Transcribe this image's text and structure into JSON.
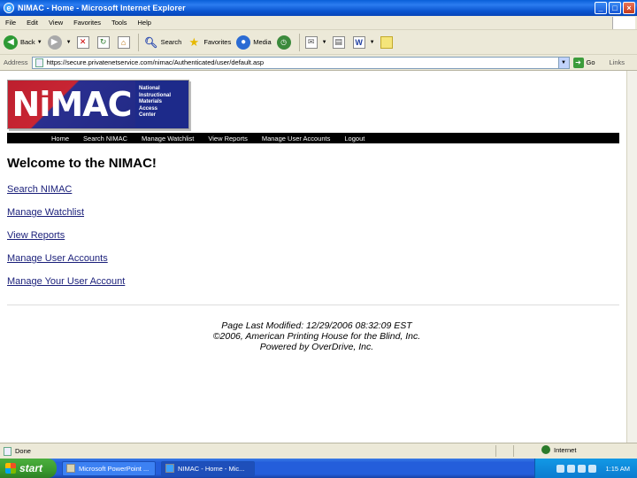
{
  "window": {
    "title": "NIMAC - Home - Microsoft Internet Explorer",
    "buttons": [
      "_",
      "□",
      "×"
    ]
  },
  "menu": [
    "File",
    "Edit",
    "View",
    "Favorites",
    "Tools",
    "Help"
  ],
  "toolbar": {
    "back": "Back",
    "search": "Search",
    "favorites": "Favorites",
    "media": "Media"
  },
  "address": {
    "label": "Address",
    "url": "https://secure.privatenetservice.com/nimac/Authenticated/user/default.asp",
    "go": "Go",
    "links": "Links"
  },
  "logo": {
    "mark": "NiMAC",
    "text_lines": [
      "National",
      "Instructional",
      "Materials",
      "Access",
      "Center"
    ]
  },
  "nav": [
    "Home",
    "Search NIMAC",
    "Manage Watchlist",
    "View Reports",
    "Manage User Accounts",
    "Logout"
  ],
  "page": {
    "heading": "Welcome to the NIMAC!",
    "links": [
      "Search NIMAC",
      "Manage Watchlist",
      "View Reports",
      "Manage User Accounts",
      "Manage Your User Account"
    ],
    "footer": [
      "Page Last Modified: 12/29/2006 08:32:09 EST",
      "©2006, American Printing House for the Blind, Inc.",
      "Powered by OverDrive, Inc."
    ]
  },
  "status": {
    "text": "Done",
    "zone": "Internet"
  },
  "taskbar": {
    "start": "start",
    "tasks": [
      "Microsoft PowerPoint ...",
      "NIMAC - Home - Mic..."
    ],
    "clock": "1:15 AM"
  }
}
